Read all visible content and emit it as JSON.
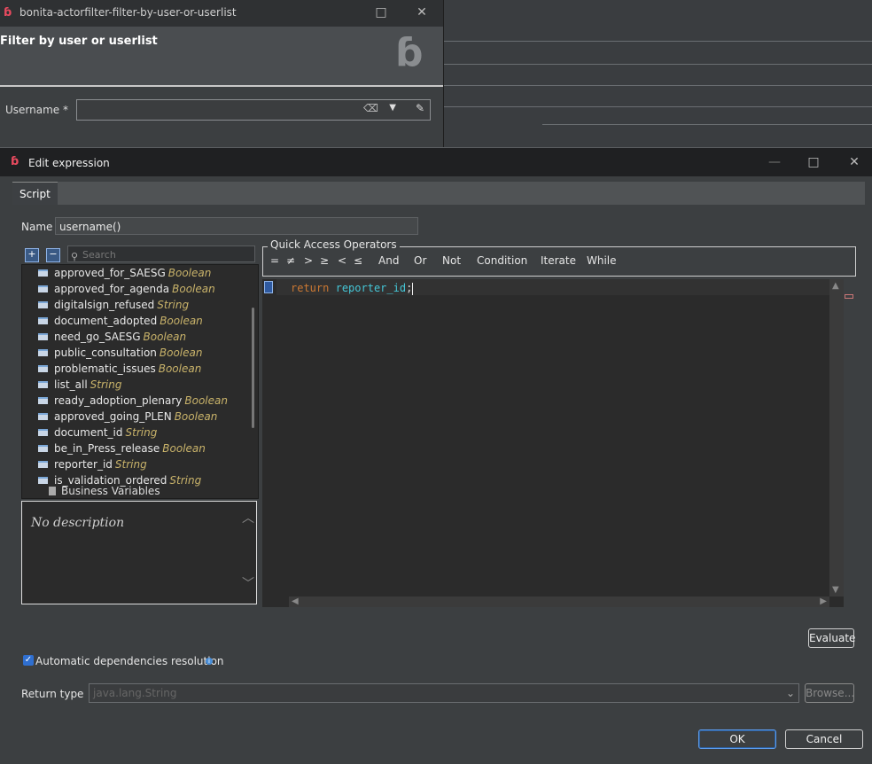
{
  "background_window": {
    "title": "bonita-actorfilter-filter-by-user-or-userlist",
    "header": "Filter by user or userlist",
    "username_label": "Username *"
  },
  "dialog": {
    "title": "Edit expression",
    "tab": "Script",
    "name_label": "Name",
    "name_value": "username()",
    "search_placeholder": "Search",
    "variables": [
      {
        "name": "approved_for_SAESG",
        "type": "Boolean"
      },
      {
        "name": "approved_for_agenda",
        "type": "Boolean"
      },
      {
        "name": "digitalsign_refused",
        "type": "String"
      },
      {
        "name": "document_adopted",
        "type": "Boolean"
      },
      {
        "name": "need_go_SAESG",
        "type": "Boolean"
      },
      {
        "name": "public_consultation",
        "type": "Boolean"
      },
      {
        "name": "problematic_issues",
        "type": "Boolean"
      },
      {
        "name": "list_all",
        "type": "String"
      },
      {
        "name": "ready_adoption_plenary",
        "type": "Boolean"
      },
      {
        "name": "approved_going_PLEN",
        "type": "Boolean"
      },
      {
        "name": "document_id",
        "type": "String"
      },
      {
        "name": "be_in_Press_release",
        "type": "Boolean"
      },
      {
        "name": "reporter_id",
        "type": "String"
      },
      {
        "name": "is_validation_ordered",
        "type": "String"
      }
    ],
    "business_variables": "Business Variables",
    "description": "No description",
    "qao_title": "Quick Access Operators",
    "operators": [
      "=",
      "≠",
      ">",
      "≥",
      "<",
      "≤",
      "And",
      "Or",
      "Not",
      "Condition",
      "Iterate",
      "While"
    ],
    "code": {
      "keyword": "return",
      "identifier": "reporter_id",
      "punct": ";"
    },
    "evaluate": "Evaluate",
    "auto_deps": "Automatic dependencies resolution",
    "return_type_label": "Return type",
    "return_type_value": "java.lang.String",
    "browse": "Browse...",
    "ok": "OK",
    "cancel": "Cancel"
  }
}
